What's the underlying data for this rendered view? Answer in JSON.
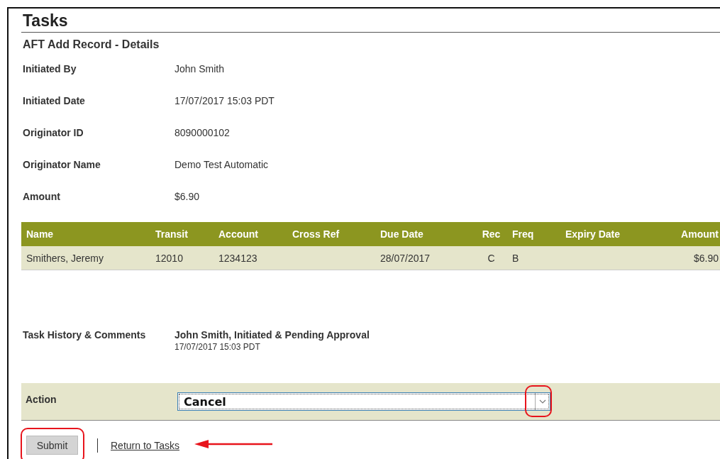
{
  "page_title": "Tasks",
  "section_title": "AFT Add Record - Details",
  "details": [
    {
      "label": "Initiated By",
      "value": "John Smith"
    },
    {
      "label": "Initiated Date",
      "value": "17/07/2017 15:03 PDT"
    },
    {
      "label": "Originator ID",
      "value": "8090000102"
    },
    {
      "label": "Originator Name",
      "value": "Demo Test Automatic"
    },
    {
      "label": "Amount",
      "value": "$6.90"
    }
  ],
  "table": {
    "columns": [
      "Name",
      "Transit",
      "Account",
      "Cross Ref",
      "Due Date",
      "Rec",
      "Freq",
      "Expiry Date",
      "Amount"
    ],
    "rows": [
      [
        "Smithers, Jeremy",
        "12010",
        "1234123",
        "",
        "28/07/2017",
        "C",
        "B",
        "",
        "$6.90"
      ]
    ]
  },
  "history": {
    "label": "Task History & Comments",
    "entry": "John Smith, Initiated & Pending Approval",
    "time": "17/07/2017 15:03 PDT"
  },
  "action": {
    "label": "Action",
    "value": "Cancel"
  },
  "buttons": {
    "submit": "Submit",
    "return_link": "Return to Tasks"
  }
}
